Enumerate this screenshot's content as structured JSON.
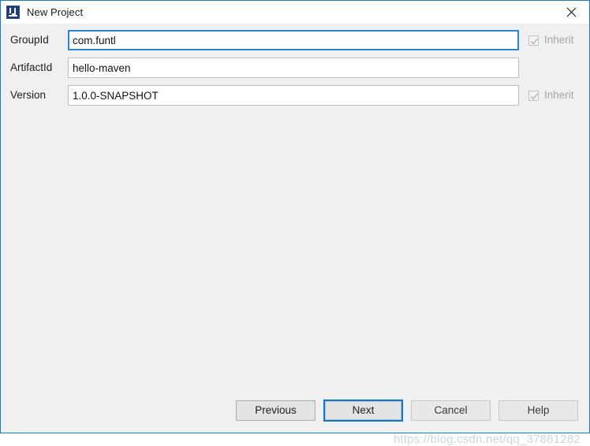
{
  "window": {
    "title": "New Project",
    "app_icon": "intellij-idea-icon",
    "close_icon": "close-icon",
    "border_color": "#1b7ac4",
    "titlebar_background": "#ffffff",
    "content_background": "#f0f0f0"
  },
  "form": {
    "fields": [
      {
        "label": "GroupId",
        "value": "com.funtl",
        "placeholder": "",
        "focused": true,
        "has_inherit": true
      },
      {
        "label": "ArtifactId",
        "value": "hello-maven",
        "placeholder": "",
        "focused": false,
        "has_inherit": false
      },
      {
        "label": "Version",
        "value": "1.0.0-SNAPSHOT",
        "placeholder": "",
        "focused": true,
        "has_inherit": true
      }
    ],
    "inherit_label": "Inherit",
    "inherit_checked": true,
    "inherit_disabled": true,
    "inherit_icon": "checkmark-icon"
  },
  "buttons": {
    "previous": "Previous",
    "next": "Next",
    "cancel": "Cancel",
    "help": "Help",
    "focused": "next",
    "focus_color": "#0b7ad1"
  },
  "watermark": {
    "text": "https://blog.csdn.net/qq_37881282",
    "color": "#cfd6da"
  }
}
